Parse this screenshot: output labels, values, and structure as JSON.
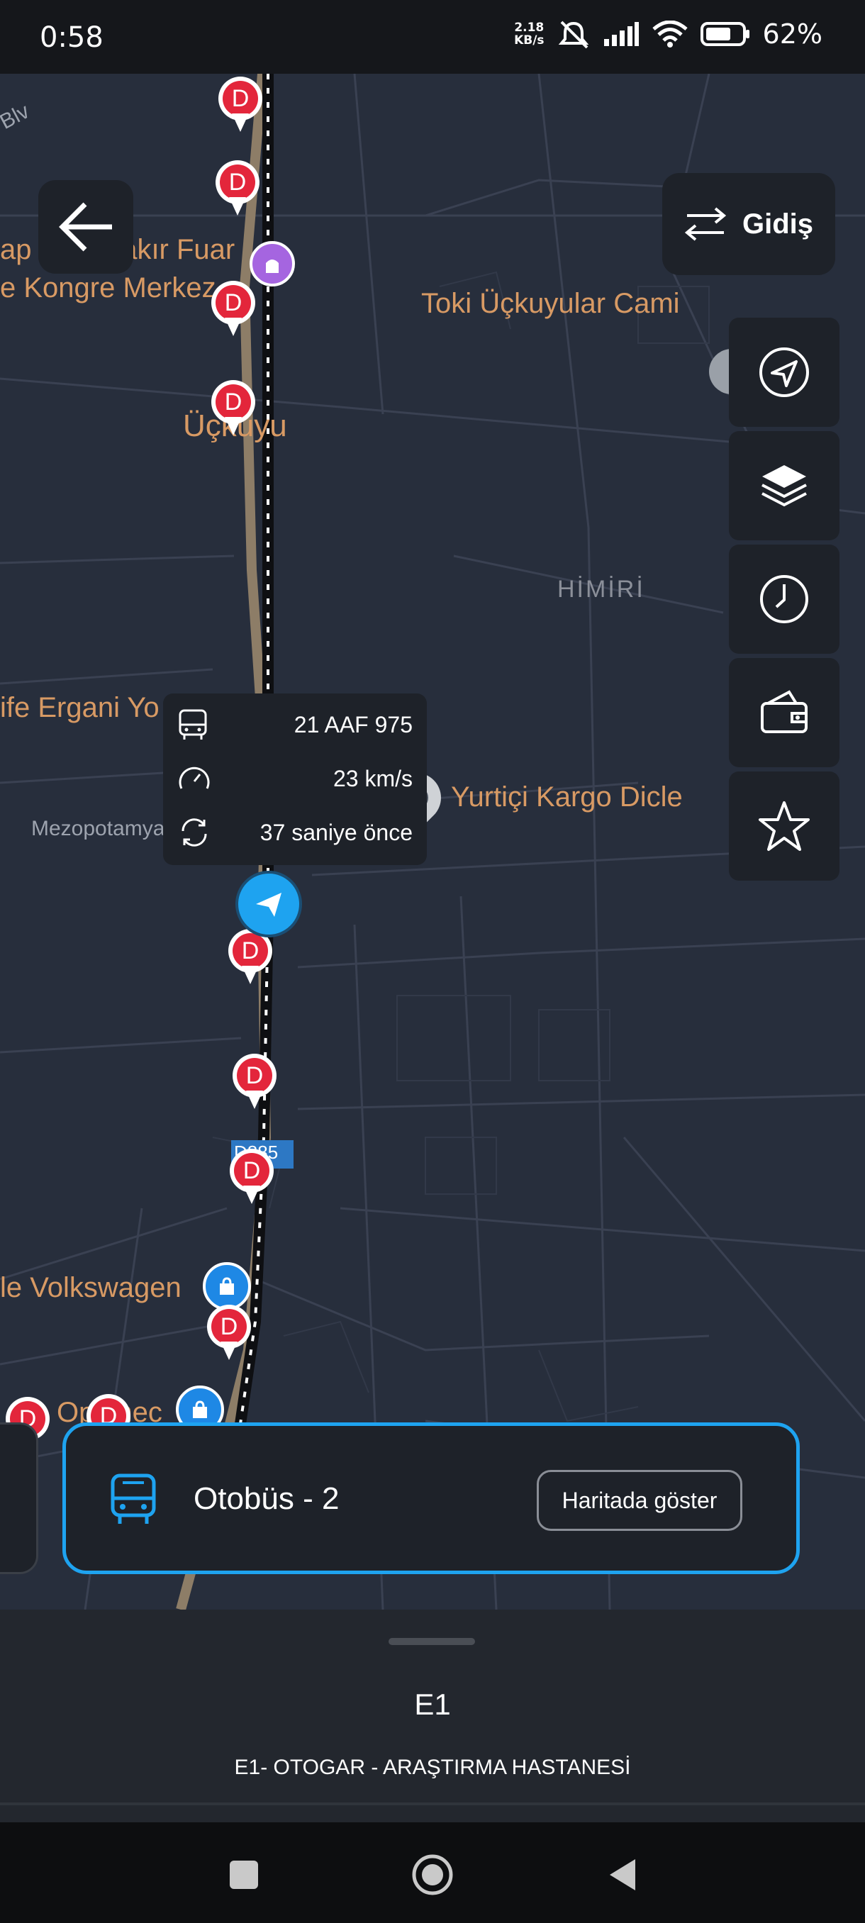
{
  "status_bar": {
    "time": "0:58",
    "net_speed_value": "2.18",
    "net_speed_unit": "KB/s",
    "battery": "62%"
  },
  "map": {
    "poi_labels": [
      "ap Diyarbakır Fuar",
      "e Kongre Merkez",
      "Toki Üçkuyular Cami",
      "Üçkuyu",
      "ife Ergani Yo",
      "Yurtiçi Kargo Dicle",
      "le Volkswagen",
      "Optimec"
    ],
    "area_label": "HİMİRİ",
    "street_label": "Mezopotamya Blv",
    "corner_street": "Blv",
    "road_shield": "D885",
    "stop_marker_letter": "D"
  },
  "direction_button": {
    "label": "Gidiş"
  },
  "vehicle_info": {
    "plate": "21 AAF 975",
    "speed": "23 km/s",
    "updated": "37 saniye önce"
  },
  "bottom_card": {
    "vehicle_name": "Otobüs - 2",
    "show_on_map": "Haritada göster"
  },
  "route": {
    "code": "E1",
    "name": "E1- OTOGAR - ARAŞTIRMA HASTANESİ"
  },
  "colors": {
    "accent": "#1ea3f0",
    "stop_red": "#e3263b",
    "poi_orange": "#d89a64",
    "map_bg": "#272e3c",
    "panel": "#1e2229"
  }
}
